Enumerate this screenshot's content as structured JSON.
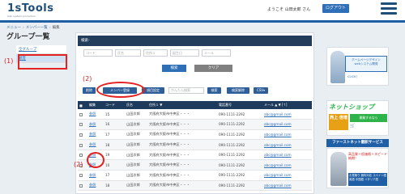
{
  "header": {
    "logo": "1sTools",
    "logo_sub": "web system production",
    "welcome": "ようこそ 山田太郎 さん",
    "logout": "ログアウト"
  },
  "breadcrumb": {
    "home": "メニュー",
    "list": "メンバー一覧",
    "current": "編集"
  },
  "page_title": "グループ一覧",
  "sidebar": {
    "items": [
      {
        "label": "全グループ"
      },
      {
        "label": "顧客"
      }
    ]
  },
  "annotations": {
    "a1": "(1)",
    "a2": "(2)",
    "a3": "(2)"
  },
  "search": {
    "header": "検索-",
    "fields": [
      "コード",
      "氏名",
      "住所１",
      "誕生日",
      "メール"
    ],
    "search_btn": "検索",
    "clear_btn": "クリア"
  },
  "toolbar": {
    "delete": "削除",
    "register": "メンバー登録",
    "settings": "項目設定",
    "simple_search_placeholder": "かんたん検索",
    "search": "検索",
    "cancel_search": "検索解除",
    "csv": "CSV▾"
  },
  "table": {
    "columns": [
      "■",
      "編集",
      "コード",
      "氏名",
      "住所１ ▼",
      "電話番号",
      "メール ▲ ▼ [↑]"
    ],
    "rows": [
      {
        "edit": "参照",
        "code": "15",
        "name": "山田次郎",
        "addr": "大阪府大阪市中央区・・・",
        "tel": "090-1111-2292",
        "email": "abc@gmail.com"
      },
      {
        "edit": "参照",
        "code": "16",
        "name": "山田次郎",
        "addr": "大阪府大阪市中央区・・・",
        "tel": "090-1111-2292",
        "email": "abc@gmail.com"
      },
      {
        "edit": "参照",
        "code": "17",
        "name": "山田次郎",
        "addr": "大阪府大阪市中央区・・・",
        "tel": "090-1111-2292",
        "email": "abc@gmail.com"
      },
      {
        "edit": "参照",
        "code": "18",
        "name": "山田次郎",
        "addr": "大阪府大阪市中央区・・・",
        "tel": "090-1111-2292",
        "email": "abc@gmail.com"
      },
      {
        "edit": "参照",
        "code": "19",
        "name": "山田次郎",
        "addr": "大阪府大阪市中央区・・・",
        "tel": "090-1111-2292",
        "email": "abc@gmail.com"
      },
      {
        "edit": "参照",
        "code": "10",
        "name": "山田次郎",
        "addr": "大阪府大阪市中央区・・・",
        "tel": "090-1111-2292",
        "email": "abc@gmail.com"
      },
      {
        "edit": "参照",
        "code": "17",
        "name": "山田次郎",
        "addr": "大阪府大阪市中央区・・・",
        "tel": "090-1111-2292",
        "email": "abc@gmail.com"
      },
      {
        "edit": "参照",
        "code": "18",
        "name": "山田次郎",
        "addr": "大阪府大阪市中央区・・・",
        "tel": "090-1111-2292",
        "email": "abc@gmail.com"
      }
    ]
  },
  "ads": {
    "ad1": {
      "text1": "ホームページデザイン",
      "text2": "webシステム開発",
      "click": "CLICK！"
    },
    "ad2": {
      "title": "ネットショップ",
      "box": "売上 倍増",
      "sub": "開業するなら",
      "sub2": "🛒"
    },
    "ad3": {
      "head": "ファーストネット翻訳サービス",
      "text": "高品質＋低価格＋スピード納期！",
      "foot": "お見積り 無料対応 スペイン語 英語 中国語 イタリア語"
    }
  }
}
